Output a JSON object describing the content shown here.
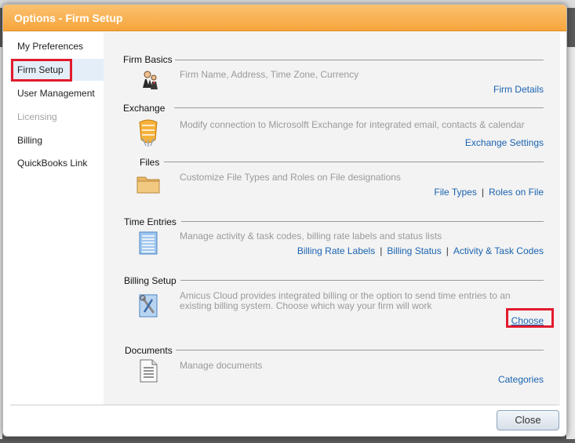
{
  "dialog": {
    "title": "Options - Firm Setup",
    "close_label": "Close"
  },
  "sidebar": {
    "items": [
      {
        "label": "My Preferences"
      },
      {
        "label": "Firm Setup"
      },
      {
        "label": "User Management"
      },
      {
        "label": "Licensing"
      },
      {
        "label": "Billing"
      },
      {
        "label": "QuickBooks Link"
      }
    ],
    "active": "Firm Setup",
    "disabled": "Licensing"
  },
  "sections": {
    "firm_basics": {
      "title": "Firm Basics",
      "description": "Firm Name, Address, Time Zone, Currency",
      "links": [
        "Firm Details"
      ]
    },
    "exchange": {
      "title": "Exchange",
      "description": "Modify connection to Microsolft Exchange for integrated email, contacts & calendar",
      "links": [
        "Exchange Settings"
      ]
    },
    "files": {
      "title": "Files",
      "description": "Customize File Types and Roles on File designations",
      "links": [
        "File Types",
        "Roles on File"
      ]
    },
    "time_entries": {
      "title": "Time Entries",
      "description": "Manage activity & task codes, billing rate labels and status lists",
      "links": [
        "Billing Rate Labels",
        "Billing Status",
        "Activity & Task Codes"
      ]
    },
    "billing_setup": {
      "title": "Billing Setup",
      "description_line1": "Amicus Cloud provides integrated billing or the option to send time entries to an",
      "description_line2": "existing billing system. Choose which way your firm will work",
      "links": [
        "Choose"
      ]
    },
    "documents": {
      "title": "Documents",
      "description": "Manage documents",
      "links": [
        "Categories"
      ]
    }
  },
  "link_separator": "|",
  "colors": {
    "title_bar": "#f6a53c",
    "link": "#1a63b0",
    "highlight": "#e21b2d",
    "active_nav": "#e4eef8"
  }
}
